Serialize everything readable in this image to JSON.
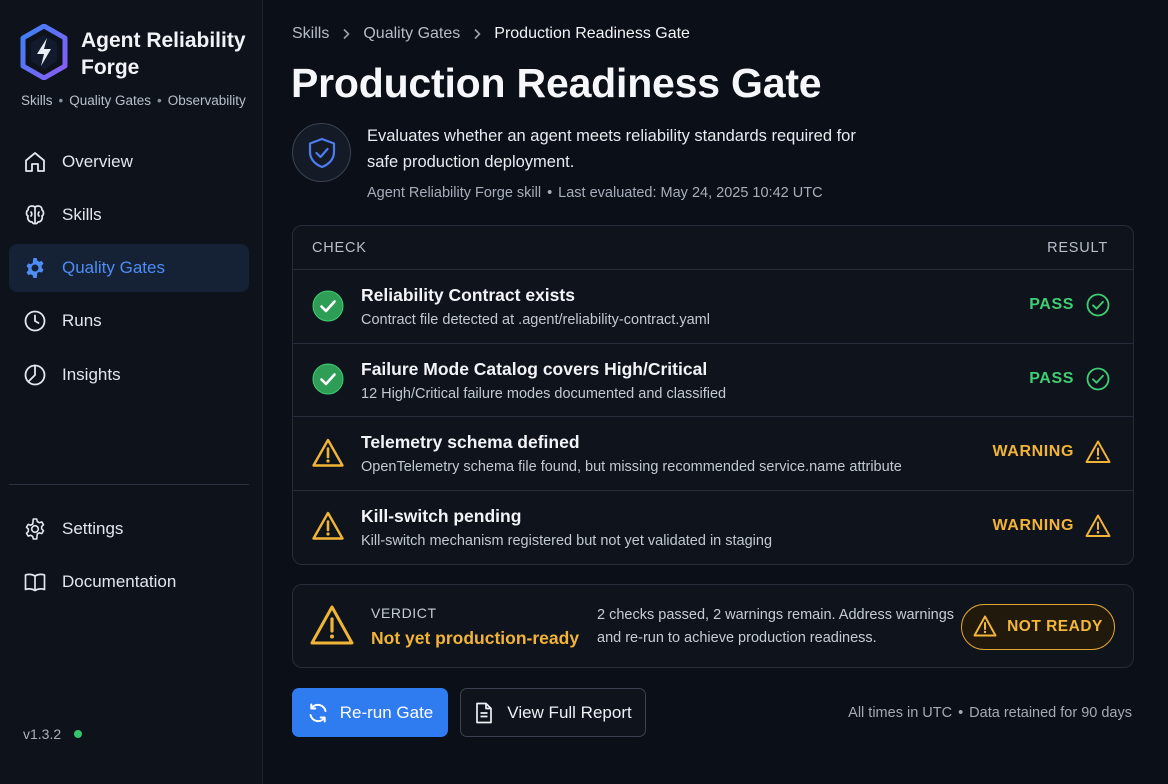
{
  "app": {
    "name": "Agent Reliability Forge",
    "subtitle_items": [
      "Skills",
      "Quality Gates",
      "Observability"
    ],
    "version": "v1.3.2"
  },
  "nav": {
    "items": [
      {
        "label": "Overview",
        "icon": "home-icon"
      },
      {
        "label": "Skills",
        "icon": "brain-icon"
      },
      {
        "label": "Quality Gates",
        "icon": "gear-icon",
        "active": true
      },
      {
        "label": "Runs",
        "icon": "clock-icon"
      },
      {
        "label": "Insights",
        "icon": "pie-chart-icon"
      }
    ],
    "bottom_items": [
      {
        "label": "Settings",
        "icon": "settings-icon"
      },
      {
        "label": "Documentation",
        "icon": "book-icon"
      }
    ]
  },
  "breadcrumb": [
    "Skills",
    "Quality Gates",
    "Production Readiness Gate"
  ],
  "gate": {
    "title": "Production Readiness Gate",
    "description": "Evaluates whether an agent meets reliability standards required for safe production deployment.",
    "source": "Agent Reliability Forge skill",
    "last_evaluated": "Last evaluated: May 24, 2025 10:42 UTC"
  },
  "checks_table": {
    "col_check": "CHECK",
    "col_result": "RESULT",
    "rows": [
      {
        "title": "Reliability Contract exists",
        "detail": "Contract file detected at .agent/reliability-contract.yaml",
        "result": "PASS",
        "status": "pass"
      },
      {
        "title": "Failure Mode Catalog covers High/Critical",
        "detail": "12 High/Critical failure modes documented and classified",
        "result": "PASS",
        "status": "pass"
      },
      {
        "title": "Telemetry schema defined",
        "detail": "OpenTelemetry schema file found, but missing recommended service.name attribute",
        "result": "WARNING",
        "status": "warning"
      },
      {
        "title": "Kill-switch pending",
        "detail": "Kill-switch mechanism registered but not yet validated in staging",
        "result": "WARNING",
        "status": "warning"
      }
    ]
  },
  "verdict": {
    "label": "VERDICT",
    "value": "Not yet production-ready",
    "description": "2 checks passed, 2 warnings remain. Address warnings and re-run to achieve production readiness.",
    "badge": "NOT READY"
  },
  "actions": {
    "rerun": "Re-run Gate",
    "report": "View Full Report"
  },
  "footer": {
    "timezone": "All times in UTC",
    "retention": "Data retained for 90 days"
  },
  "colors": {
    "accent": "#2f7bf0",
    "pass": "#3fcf73",
    "warning": "#f2b437",
    "background": "#0b0f17"
  }
}
